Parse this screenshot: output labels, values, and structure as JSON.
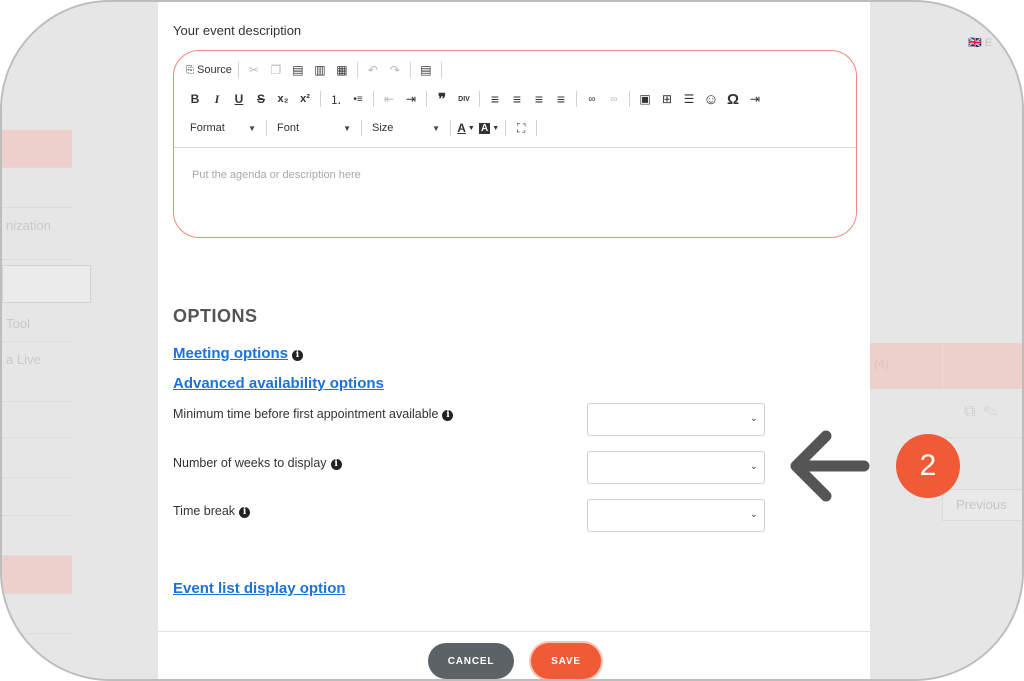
{
  "background": {
    "left_panel": {
      "items": [
        "nization",
        "Tool",
        "a Live"
      ]
    },
    "right_panel": {
      "language_label": "🇬🇧 E",
      "table_header": "(4)",
      "previous_button": "Previous"
    }
  },
  "modal": {
    "description_label": "Your event description",
    "editor": {
      "toolbar_row1": [
        {
          "name": "source",
          "label": "Source",
          "icon": "⎘"
        },
        {
          "name": "cut",
          "icon": "✂",
          "disabled": true
        },
        {
          "name": "copy",
          "icon": "❐",
          "disabled": true
        },
        {
          "name": "paste",
          "icon": "📋"
        },
        {
          "name": "paste-text",
          "icon": "T"
        },
        {
          "name": "paste-word",
          "icon": "W"
        },
        {
          "name": "undo",
          "icon": "↶",
          "disabled": true
        },
        {
          "name": "redo",
          "icon": "↷",
          "disabled": true
        },
        {
          "name": "templates",
          "icon": "▤"
        }
      ],
      "toolbar_row2": [
        {
          "name": "bold",
          "icon": "B"
        },
        {
          "name": "italic",
          "icon": "I"
        },
        {
          "name": "underline",
          "icon": "U"
        },
        {
          "name": "strikethrough",
          "icon": "S"
        },
        {
          "name": "subscript",
          "icon": "x₂"
        },
        {
          "name": "superscript",
          "icon": "x²"
        },
        {
          "name": "numbered-list",
          "icon": "⒈"
        },
        {
          "name": "bulleted-list",
          "icon": "•≡"
        },
        {
          "name": "decrease-indent",
          "icon": "⇤"
        },
        {
          "name": "increase-indent",
          "icon": "⇥"
        },
        {
          "name": "blockquote",
          "icon": "❞"
        },
        {
          "name": "create-div",
          "icon": "DIV"
        },
        {
          "name": "align-left",
          "icon": "≡"
        },
        {
          "name": "align-center",
          "icon": "≡"
        },
        {
          "name": "align-right",
          "icon": "≡"
        },
        {
          "name": "justify",
          "icon": "≡"
        },
        {
          "name": "link",
          "icon": "🔗"
        },
        {
          "name": "unlink",
          "icon": "⛓",
          "disabled": true
        },
        {
          "name": "image",
          "icon": "▣"
        },
        {
          "name": "table",
          "icon": "⊞"
        },
        {
          "name": "horizontal-line",
          "icon": "☰"
        },
        {
          "name": "smiley",
          "icon": "☺"
        },
        {
          "name": "special-char",
          "icon": "Ω"
        },
        {
          "name": "page-break",
          "icon": "⇥"
        }
      ],
      "format_label": "Format",
      "font_label": "Font",
      "size_label": "Size",
      "text_color_icon": "A",
      "bg_color_icon": "A",
      "maximize_icon": "⛶",
      "placeholder": "Put the agenda or description here"
    },
    "options_title": "OPTIONS",
    "meeting_options_link": "Meeting options",
    "advanced_availability_link": "Advanced availability options",
    "fields": [
      {
        "label": "Minimum time before first appointment available",
        "value": ""
      },
      {
        "label": "Number of weeks to display",
        "value": ""
      },
      {
        "label": "Time break",
        "value": ""
      }
    ],
    "event_list_link": "Event list display option",
    "cancel_label": "CANCEL",
    "save_label": "SAVE"
  },
  "annotation": {
    "step_number": "2"
  },
  "colors": {
    "accent": "#f15a37",
    "link": "#1a73d9",
    "cancel": "#5d6266"
  }
}
